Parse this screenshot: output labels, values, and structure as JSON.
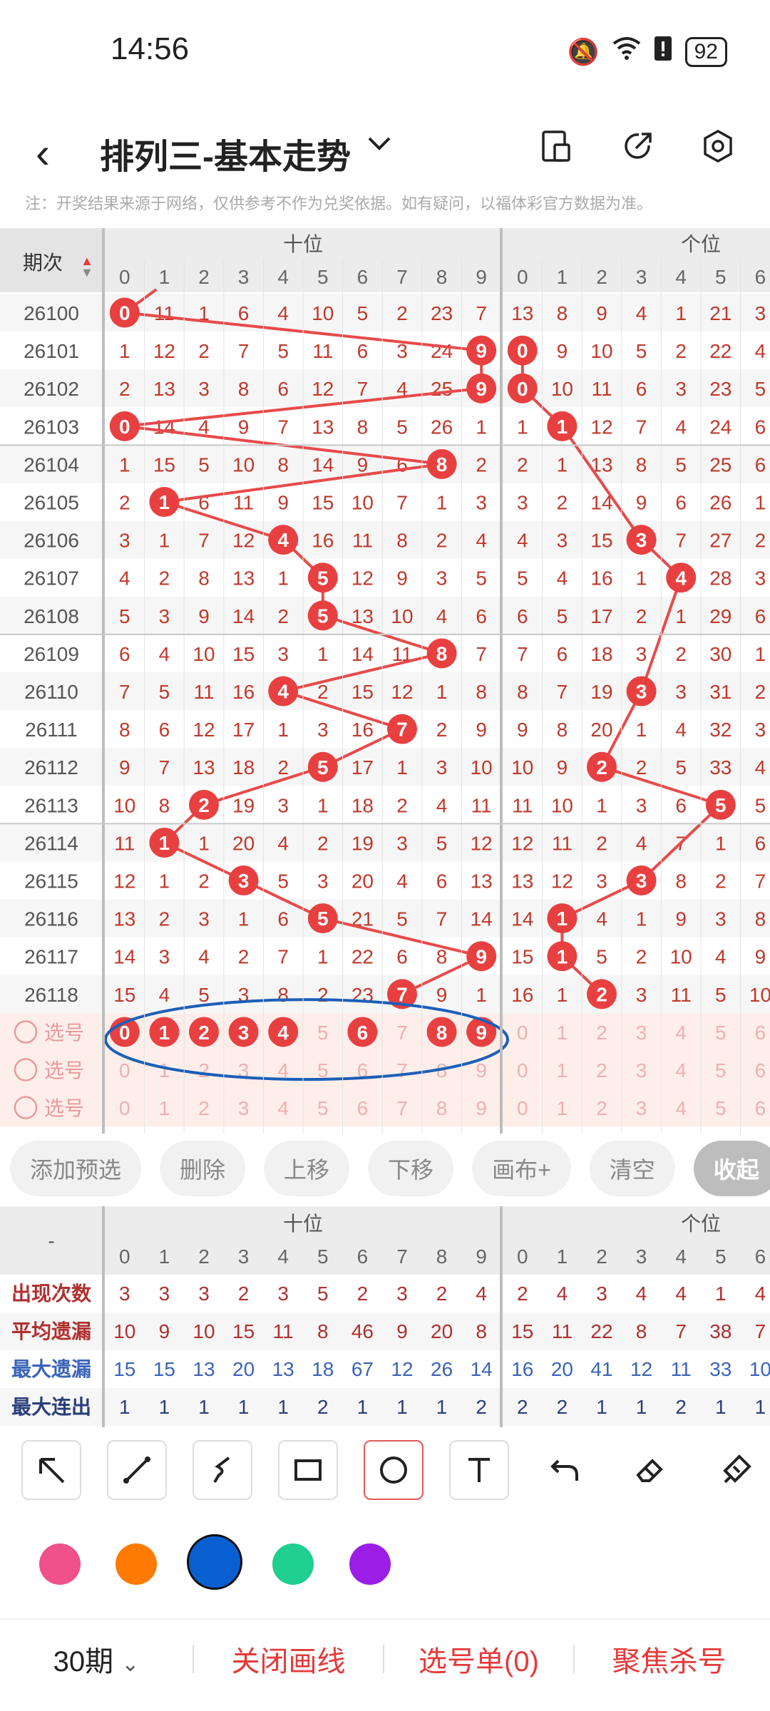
{
  "status_bar": {
    "time": "14:56",
    "battery": "92"
  },
  "header": {
    "title": "排列三-基本走势"
  },
  "note": "注：开奖结果来源于网络，仅供参考不作为兑奖依据。如有疑问，以福体彩官方数据为准。",
  "grid": {
    "period_label": "期次",
    "group_labels": [
      "十位",
      "个位"
    ],
    "digits": [
      "0",
      "1",
      "2",
      "3",
      "4",
      "5",
      "6",
      "7",
      "8",
      "9"
    ],
    "ones_visible_digits": [
      "0",
      "1",
      "2",
      "3",
      "4",
      "5",
      "6"
    ],
    "rows": [
      {
        "period": "26100",
        "tens": [
          "0",
          "11",
          "1",
          "6",
          "4",
          "10",
          "5",
          "2",
          "23",
          "7"
        ],
        "ones": [
          "13",
          "8",
          "9",
          "4",
          "1",
          "21",
          "3"
        ]
      },
      {
        "period": "26101",
        "tens": [
          "1",
          "12",
          "2",
          "7",
          "5",
          "11",
          "6",
          "3",
          "24",
          "9"
        ],
        "ones": [
          "0",
          "9",
          "10",
          "5",
          "2",
          "22",
          "4"
        ]
      },
      {
        "period": "26102",
        "tens": [
          "2",
          "13",
          "3",
          "8",
          "6",
          "12",
          "7",
          "4",
          "25",
          "9"
        ],
        "ones": [
          "0",
          "10",
          "11",
          "6",
          "3",
          "23",
          "5"
        ]
      },
      {
        "period": "26103",
        "tens": [
          "0",
          "14",
          "4",
          "9",
          "7",
          "13",
          "8",
          "5",
          "26",
          "1"
        ],
        "ones": [
          "1",
          "1",
          "12",
          "7",
          "4",
          "24",
          "6"
        ]
      },
      {
        "period": "26104",
        "tens": [
          "1",
          "15",
          "5",
          "10",
          "8",
          "14",
          "9",
          "6",
          "8",
          "2"
        ],
        "ones": [
          "2",
          "1",
          "13",
          "8",
          "5",
          "25",
          "6"
        ]
      },
      {
        "period": "26105",
        "tens": [
          "2",
          "1",
          "6",
          "11",
          "9",
          "15",
          "10",
          "7",
          "1",
          "3"
        ],
        "ones": [
          "3",
          "2",
          "14",
          "9",
          "6",
          "26",
          "1"
        ]
      },
      {
        "period": "26106",
        "tens": [
          "3",
          "1",
          "7",
          "12",
          "4",
          "16",
          "11",
          "8",
          "2",
          "4"
        ],
        "ones": [
          "4",
          "3",
          "15",
          "3",
          "7",
          "27",
          "2"
        ]
      },
      {
        "period": "26107",
        "tens": [
          "4",
          "2",
          "8",
          "13",
          "1",
          "5",
          "12",
          "9",
          "3",
          "5"
        ],
        "ones": [
          "5",
          "4",
          "16",
          "1",
          "4",
          "28",
          "3"
        ]
      },
      {
        "period": "26108",
        "tens": [
          "5",
          "3",
          "9",
          "14",
          "2",
          "5",
          "13",
          "10",
          "4",
          "6"
        ],
        "ones": [
          "6",
          "5",
          "17",
          "2",
          "1",
          "29",
          "6"
        ]
      },
      {
        "period": "26109",
        "tens": [
          "6",
          "4",
          "10",
          "15",
          "3",
          "1",
          "14",
          "11",
          "8",
          "7"
        ],
        "ones": [
          "7",
          "6",
          "18",
          "3",
          "2",
          "30",
          "1"
        ]
      },
      {
        "period": "26110",
        "tens": [
          "7",
          "5",
          "11",
          "16",
          "4",
          "2",
          "15",
          "12",
          "1",
          "8"
        ],
        "ones": [
          "8",
          "7",
          "19",
          "3",
          "3",
          "31",
          "2"
        ]
      },
      {
        "period": "26111",
        "tens": [
          "8",
          "6",
          "12",
          "17",
          "1",
          "3",
          "16",
          "7",
          "2",
          "9"
        ],
        "ones": [
          "9",
          "8",
          "20",
          "1",
          "4",
          "32",
          "3"
        ]
      },
      {
        "period": "26112",
        "tens": [
          "9",
          "7",
          "13",
          "18",
          "2",
          "5",
          "17",
          "1",
          "3",
          "10"
        ],
        "ones": [
          "10",
          "9",
          "2",
          "2",
          "5",
          "33",
          "4"
        ]
      },
      {
        "period": "26113",
        "tens": [
          "10",
          "8",
          "2",
          "19",
          "3",
          "1",
          "18",
          "2",
          "4",
          "11"
        ],
        "ones": [
          "11",
          "10",
          "1",
          "3",
          "6",
          "5",
          "5"
        ]
      },
      {
        "period": "26114",
        "tens": [
          "11",
          "1",
          "1",
          "20",
          "4",
          "2",
          "19",
          "3",
          "5",
          "12"
        ],
        "ones": [
          "12",
          "11",
          "2",
          "4",
          "7",
          "1",
          "6"
        ]
      },
      {
        "period": "26115",
        "tens": [
          "12",
          "1",
          "2",
          "3",
          "5",
          "3",
          "20",
          "4",
          "6",
          "13"
        ],
        "ones": [
          "13",
          "12",
          "3",
          "3",
          "8",
          "2",
          "7"
        ]
      },
      {
        "period": "26116",
        "tens": [
          "13",
          "2",
          "3",
          "1",
          "6",
          "5",
          "21",
          "5",
          "7",
          "14"
        ],
        "ones": [
          "14",
          "1",
          "4",
          "1",
          "9",
          "3",
          "8"
        ]
      },
      {
        "period": "26117",
        "tens": [
          "14",
          "3",
          "4",
          "2",
          "7",
          "1",
          "22",
          "6",
          "8",
          "9"
        ],
        "ones": [
          "15",
          "1",
          "5",
          "2",
          "10",
          "4",
          "9"
        ]
      },
      {
        "period": "26118",
        "tens": [
          "15",
          "4",
          "5",
          "3",
          "8",
          "2",
          "23",
          "7",
          "9",
          "1"
        ],
        "ones": [
          "16",
          "1",
          "2",
          "3",
          "11",
          "5",
          "10"
        ]
      }
    ],
    "select_label": "选号"
  },
  "toolbar": [
    "添加预选",
    "删除",
    "上移",
    "下移",
    "画布+",
    "清空",
    "收起"
  ],
  "stats": {
    "corner": "-",
    "rows": [
      {
        "label": "出现次数",
        "tens": [
          "3",
          "3",
          "3",
          "2",
          "3",
          "5",
          "2",
          "3",
          "2",
          "4"
        ],
        "ones": [
          "2",
          "4",
          "3",
          "4",
          "4",
          "1",
          "4"
        ]
      },
      {
        "label": "平均遗漏",
        "tens": [
          "10",
          "9",
          "10",
          "15",
          "11",
          "8",
          "46",
          "9",
          "20",
          "8"
        ],
        "ones": [
          "15",
          "11",
          "22",
          "8",
          "7",
          "38",
          "7"
        ]
      },
      {
        "label": "最大遗漏",
        "tens": [
          "15",
          "15",
          "13",
          "20",
          "13",
          "18",
          "67",
          "12",
          "26",
          "14"
        ],
        "ones": [
          "16",
          "20",
          "41",
          "12",
          "11",
          "33",
          "10"
        ]
      },
      {
        "label": "最大连出",
        "tens": [
          "1",
          "1",
          "1",
          "1",
          "1",
          "2",
          "1",
          "1",
          "1",
          "2"
        ],
        "ones": [
          "2",
          "2",
          "1",
          "1",
          "2",
          "1",
          "1"
        ]
      }
    ]
  },
  "draw_tools": [
    "arrow-tool-icon",
    "line-tool-icon",
    "curve-tool-icon",
    "rect-tool-icon",
    "circle-tool-icon",
    "text-tool-icon",
    "undo-icon",
    "eraser-icon",
    "clear-brush-icon"
  ],
  "colors": [
    "#f0518a",
    "#ff7a00",
    "#0a5fd0",
    "#1fcf8f",
    "#9b1de6"
  ],
  "bottom": {
    "periods": "30期",
    "close_draw": "关闭画线",
    "select_list": "选号单(0)",
    "focus_kill": "聚焦杀号"
  }
}
